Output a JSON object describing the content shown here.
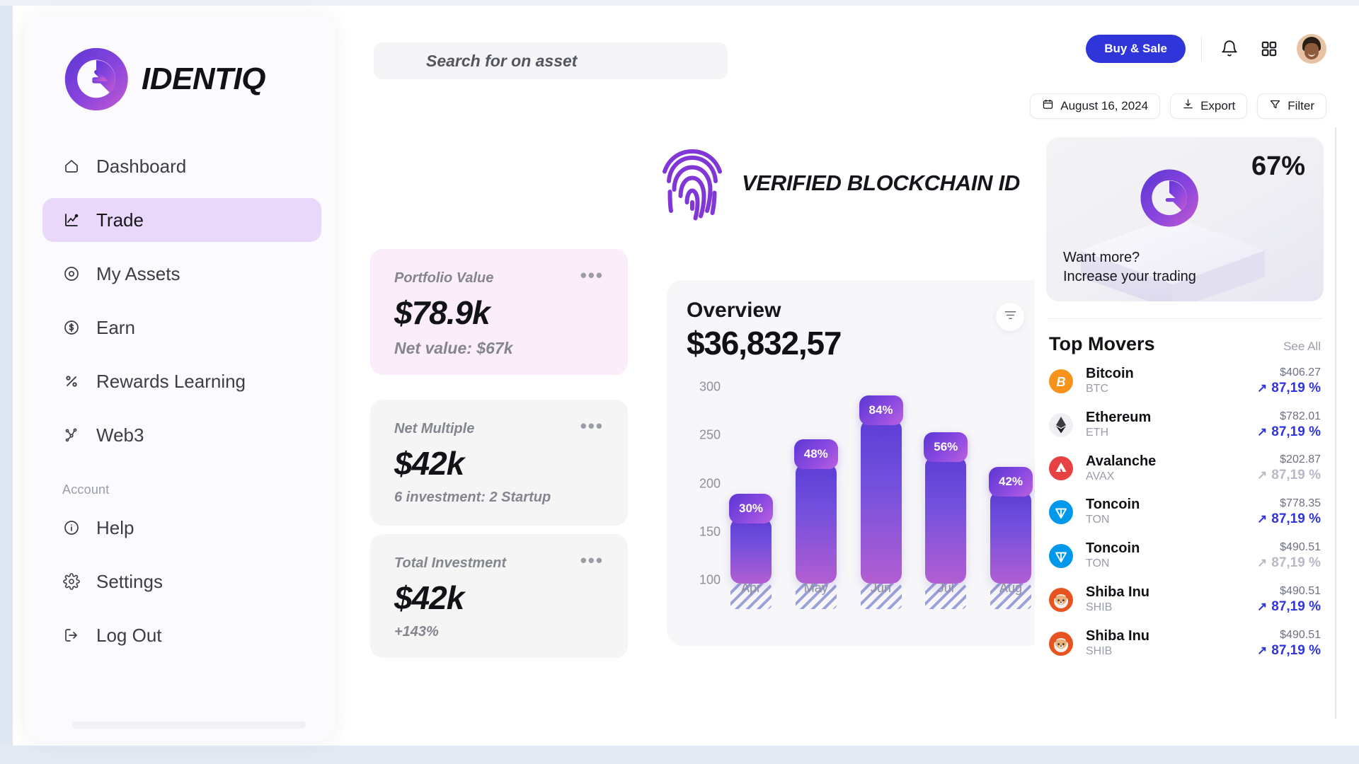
{
  "brand": {
    "name": "IDENTIQ",
    "logo_icon": "q-logo-icon",
    "accent": "#7a3fd8",
    "primary": "#2f35d8"
  },
  "sidebar": {
    "items": [
      {
        "label": "Dashboard",
        "icon": "home-icon",
        "active": false
      },
      {
        "label": "Trade",
        "icon": "chart-line-icon",
        "active": true
      },
      {
        "label": "My Assets",
        "icon": "compass-icon",
        "active": false
      },
      {
        "label": "Earn",
        "icon": "dollar-circle-icon",
        "active": false
      },
      {
        "label": "Rewards Learning",
        "icon": "percent-icon",
        "active": false
      },
      {
        "label": "Web3",
        "icon": "web3-node-icon",
        "active": false
      }
    ],
    "section_label": "Account",
    "account_items": [
      {
        "label": "Help",
        "icon": "info-circle-icon"
      },
      {
        "label": "Settings",
        "icon": "gear-icon"
      },
      {
        "label": "Log Out",
        "icon": "logout-icon"
      }
    ]
  },
  "search": {
    "placeholder": "Search for on asset",
    "value": "",
    "icon": "search-icon"
  },
  "header": {
    "buy_sale_label": "Buy & Sale",
    "bell_icon": "bell-icon",
    "grid_icon": "grid-apps-icon",
    "avatar_icon": "user-avatar"
  },
  "toolbar": {
    "date_label": "August 16, 2024",
    "date_icon": "calendar-icon",
    "export_label": "Export",
    "export_icon": "download-icon",
    "filter_label": "Filter",
    "filter_icon": "funnel-icon"
  },
  "verified_banner": {
    "text": "VERIFIED BLOCKCHAIN ID",
    "icon": "fingerprint-icon"
  },
  "stat_cards": [
    {
      "label": "Portfolio Value",
      "value": "$78.9k",
      "sub": "Net value: $67k",
      "menu_icon": "more-dots-icon",
      "bg": "#fbedf9"
    },
    {
      "label": "Net Multiple",
      "value": "$42k",
      "sub": "6 investment: 2 Startup",
      "menu_icon": "more-dots-icon",
      "bg": "#f4f5f4"
    },
    {
      "label": "Total Investment",
      "value": "$42k",
      "sub": "+143%",
      "menu_icon": "more-dots-icon",
      "bg": "#f4f5f4"
    }
  ],
  "chart_card": {
    "title": "Overview",
    "amount": "$36,832,57",
    "filter_icon": "filter-lines-icon"
  },
  "chart_data": {
    "type": "bar",
    "title": "Overview",
    "subtitle": "$36,832,57",
    "categories": [
      "Apr",
      "May",
      "Jun",
      "Jul",
      "Aug"
    ],
    "values": [
      168,
      225,
      270,
      232,
      196
    ],
    "labels": [
      "30%",
      "48%",
      "84%",
      "56%",
      "42%"
    ],
    "series": [
      {
        "name": "Solid segment",
        "values": [
          168,
          225,
          270,
          232,
          196
        ]
      },
      {
        "name": "Hatched base",
        "values": [
          100,
          100,
          100,
          100,
          100
        ]
      }
    ],
    "xlabel": "",
    "ylabel": "",
    "ylim": [
      85,
      315
    ],
    "yticks": [
      100,
      150,
      200,
      250,
      300
    ],
    "grid": false,
    "legend": "none"
  },
  "promo": {
    "percent": "67%",
    "line1": "Want more?",
    "line2": "Increase your trading",
    "logo_icon": "q-logo-icon"
  },
  "top_movers": {
    "title": "Top Movers",
    "see_all_label": "See All",
    "rows": [
      {
        "name": "Bitcoin",
        "symbol": "BTC",
        "price": "$406.27",
        "change": "87,19 %",
        "dim": false,
        "icon": "bitcoin-icon",
        "color": "#f7931a"
      },
      {
        "name": "Ethereum",
        "symbol": "ETH",
        "price": "$782.01",
        "change": "87,19 %",
        "dim": false,
        "icon": "ethereum-icon",
        "color": "#eef0f3"
      },
      {
        "name": "Avalanche",
        "symbol": "AVAX",
        "price": "$202.87",
        "change": "87,19 %",
        "dim": true,
        "icon": "avalanche-icon",
        "color": "#e84142"
      },
      {
        "name": "Toncoin",
        "symbol": "TON",
        "price": "$778.35",
        "change": "87,19 %",
        "dim": false,
        "icon": "toncoin-icon",
        "color": "#0098ea"
      },
      {
        "name": "Toncoin",
        "symbol": "TON",
        "price": "$490.51",
        "change": "87,19 %",
        "dim": true,
        "icon": "toncoin-icon",
        "color": "#0098ea"
      },
      {
        "name": "Shiba Inu",
        "symbol": "SHIB",
        "price": "$490.51",
        "change": "87,19 %",
        "dim": false,
        "icon": "shiba-icon",
        "color": "#e8541f"
      },
      {
        "name": "Shiba Inu",
        "symbol": "SHIB",
        "price": "$490.51",
        "change": "87,19 %",
        "dim": false,
        "icon": "shiba-icon",
        "color": "#e8541f"
      }
    ]
  }
}
